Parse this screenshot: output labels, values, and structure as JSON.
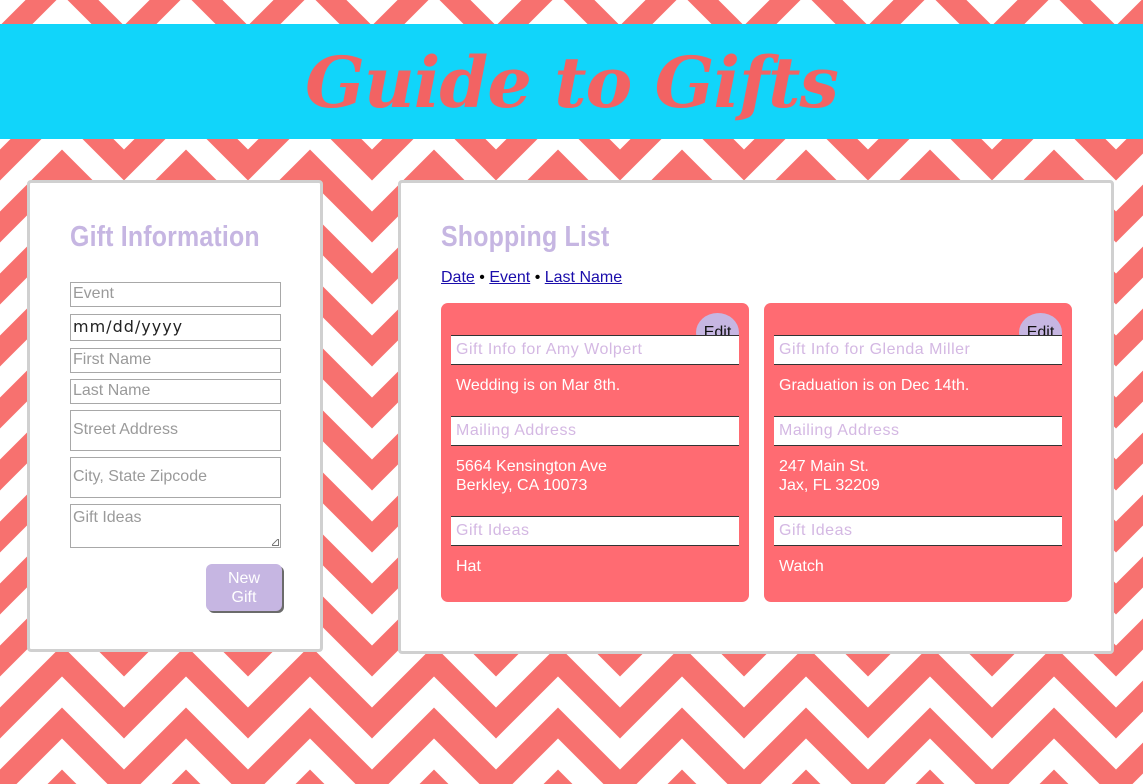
{
  "app": {
    "title": "Guide to Gifts"
  },
  "form": {
    "heading": "Gift Information",
    "event_placeholder": "Event",
    "date_value": "mm/dd/yyyy",
    "first_name_placeholder": "First Name",
    "last_name_placeholder": "Last Name",
    "street_placeholder": "Street Address",
    "city_placeholder": "City, State Zipcode",
    "ideas_placeholder": "Gift Ideas",
    "new_gift_label_1": "New",
    "new_gift_label_2": "Gift"
  },
  "list": {
    "heading": "Shopping List",
    "sort": {
      "date": "Date",
      "event": "Event",
      "last_name": "Last Name",
      "separator": "•"
    },
    "cards": [
      {
        "edit": "Edit",
        "info_header": "Gift Info for Amy Wolpert",
        "event_text": "Wedding is on Mar 8th.",
        "mailing_header": "Mailing Address",
        "address_line1": "5664 Kensington Ave",
        "address_line2": "Berkley, CA 10073",
        "ideas_header": "Gift Ideas",
        "ideas": "Hat"
      },
      {
        "edit": "Edit",
        "info_header": "Gift Info for Glenda Miller",
        "event_text": "Graduation is on Dec 14th.",
        "mailing_header": "Mailing Address",
        "address_line1": "247 Main St.",
        "address_line2": "Jax, FL 32209",
        "ideas_header": "Gift Ideas",
        "ideas": "Watch"
      }
    ]
  },
  "colors": {
    "header_bg": "#11d5fa",
    "title": "#f26363",
    "accent_lavender": "#c6b6e2",
    "card": "#ff6b72",
    "background_coral": "#f7716f"
  }
}
